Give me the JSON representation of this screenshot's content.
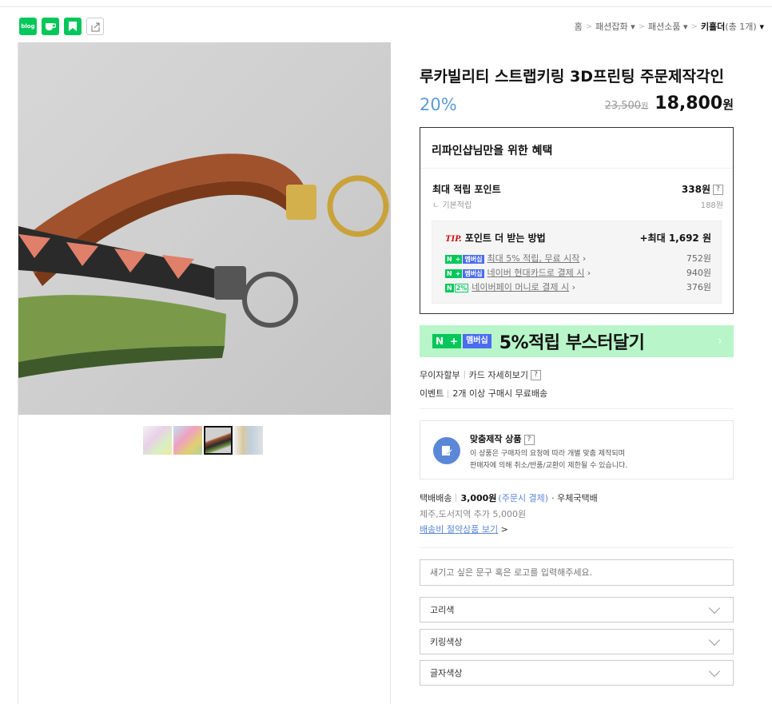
{
  "share": {
    "blog_label": "blog",
    "icons": [
      "blog-icon",
      "cafe-icon",
      "bookmark-icon",
      "share-icon"
    ]
  },
  "breadcrumb": {
    "home": "홈",
    "cat1": "패션잡화",
    "cat2": "패션소품",
    "current": "키홀더",
    "count": "(총 1개)"
  },
  "product": {
    "title": "루카빌리티 스트랩키링 3D프린팅 주문제작각인",
    "discount": "20%",
    "original_price": "23,500",
    "original_unit": "원",
    "sale_price": "18,800",
    "sale_unit": "원"
  },
  "benefit": {
    "heading": "리파인샵님만을 위한 혜택",
    "points_label": "최대 적립 포인트",
    "points_value": "338원",
    "help": "?",
    "base_label": "ㄴ 기본적립",
    "base_value": "188원",
    "tip_prefix": "TIP.",
    "tip_label": "포인트 더 받는 방법",
    "tip_max": "+최대 1,692 원",
    "tips": [
      {
        "text": "최대 5% 적립, 무료 시작",
        "value": "752원"
      },
      {
        "text": "네이버 현대카드로 결제 시",
        "value": "940원"
      },
      {
        "text": "네이버페이 머니로 결제 시",
        "value": "376원"
      }
    ],
    "badge_n": "N",
    "badge_plus": "+",
    "badge_mem": "멤버십",
    "badge_pct": "2%"
  },
  "booster": {
    "badge_n": "N",
    "badge_plus": "+",
    "badge_mem": "멤버십",
    "text": "5%적립 부스터달기",
    "arrow": "›"
  },
  "meta": {
    "installment": "무이자할부",
    "card_detail": "카드 자세히보기",
    "help": "?",
    "event_label": "이벤트",
    "event_text": "2개 이상 구매시 무료배송"
  },
  "custom_product": {
    "title": "맞춤제작 상품",
    "help": "?",
    "desc1": "이 상품은 구매자의 요청에 따라 개별 맞춤 제작되며",
    "desc2": "판매자에 의해 취소/반품/교환이 제한될 수 있습니다."
  },
  "shipping": {
    "label": "택배배송",
    "fee": "3,000원",
    "pay": "(주문시 결제)",
    "carrier": "· 우체국택배",
    "extra": "제주,도서지역 추가 5,000원",
    "saving_link": "배송비 절약상품 보기",
    "saving_arrow": ">"
  },
  "options": {
    "engrave_placeholder": "새기고 싶은 문구 혹은 로고를 입력해주세요.",
    "selects": [
      "고리색",
      "키링색상",
      "글자색상"
    ]
  }
}
